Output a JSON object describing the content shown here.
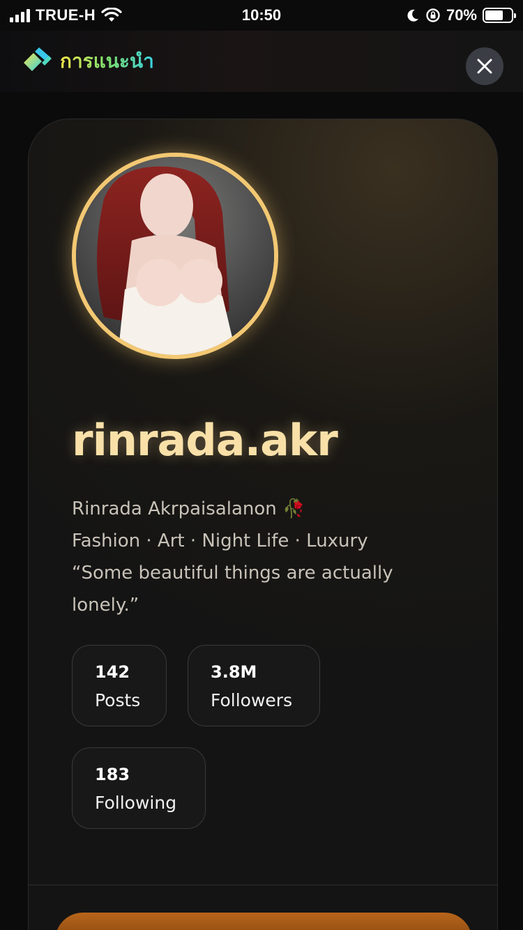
{
  "status_bar": {
    "carrier": "TRUE-H",
    "time": "10:50",
    "battery_percent": "70%",
    "battery_level": 0.7
  },
  "header": {
    "title": "การแนะนำ",
    "close_icon": "close-icon",
    "logo_icon": "app-logo-icon"
  },
  "profile": {
    "username": "rinrada.akr",
    "avatar_icon": "profile-avatar",
    "bio": [
      "Rinrada Akrpaisalanon 🥀",
      "Fashion · Art · Night Life · Luxury",
      "“Some beautiful things are actually",
      "lonely.”"
    ],
    "stats": [
      {
        "value": "142",
        "label": "Posts"
      },
      {
        "value": "3.8M",
        "label": "Followers"
      },
      {
        "value": "183",
        "label": "Following"
      }
    ]
  },
  "colors": {
    "accent_gold": "#f3c873",
    "username": "#f8e0a8",
    "background": "#0b0b0b"
  }
}
